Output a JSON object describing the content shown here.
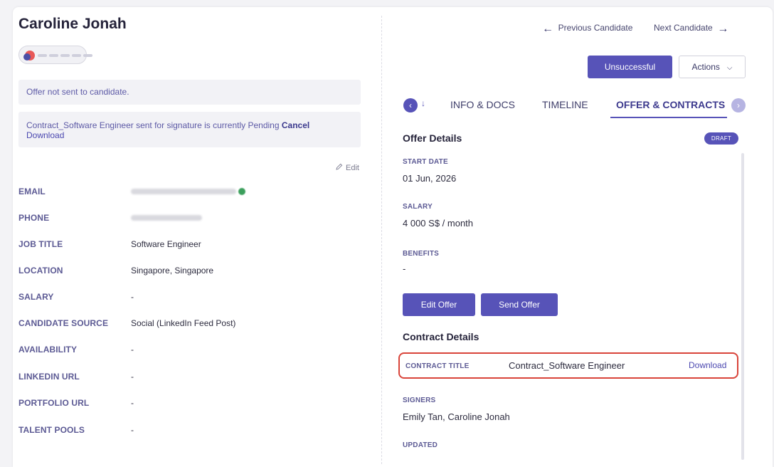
{
  "candidate": {
    "name": "Caroline Jonah"
  },
  "notices": {
    "offer_status": "Offer not sent to candidate.",
    "contract_status": "Contract_Software Engineer sent for signature is currently Pending",
    "cancel_label": "Cancel",
    "download_label": "Download"
  },
  "profile": {
    "edit_label": "Edit",
    "fields": [
      {
        "label": "EMAIL",
        "value": ""
      },
      {
        "label": "PHONE",
        "value": ""
      },
      {
        "label": "JOB TITLE",
        "value": "Software Engineer"
      },
      {
        "label": "LOCATION",
        "value": "Singapore, Singapore"
      },
      {
        "label": "SALARY",
        "value": "-"
      },
      {
        "label": "CANDIDATE SOURCE",
        "value": "Social (LinkedIn Feed Post)"
      },
      {
        "label": "AVAILABILITY",
        "value": "-"
      },
      {
        "label": "LINKEDIN URL",
        "value": "-"
      },
      {
        "label": "PORTFOLIO URL",
        "value": "-"
      },
      {
        "label": "TALENT POOLS",
        "value": "-"
      }
    ]
  },
  "navigation": {
    "previous_label": "Previous Candidate",
    "next_label": "Next Candidate"
  },
  "actions": {
    "unsuccessful_label": "Unsuccessful",
    "actions_label": "Actions"
  },
  "tabs": {
    "info_docs": "INFO & DOCS",
    "timeline": "TIMELINE",
    "offer_contracts": "OFFER & CONTRACTS",
    "active": "offer_contracts"
  },
  "offer": {
    "title": "Offer Details",
    "badge": "DRAFT",
    "start_date_label": "START DATE",
    "start_date": "01 Jun, 2026",
    "salary_label": "SALARY",
    "salary": "4 000 S$ / month",
    "benefits_label": "BENEFITS",
    "benefits": "-",
    "edit_offer_label": "Edit Offer",
    "send_offer_label": "Send Offer"
  },
  "contract": {
    "title": "Contract Details",
    "contract_title_label": "CONTRACT TITLE",
    "contract_title": "Contract_Software Engineer",
    "download_label": "Download",
    "signers_label": "SIGNERS",
    "signers": "Emily Tan, Caroline Jonah",
    "updated_label": "UPDATED"
  },
  "colors": {
    "accent": "#5753b8",
    "highlight_border": "#d9443a"
  }
}
